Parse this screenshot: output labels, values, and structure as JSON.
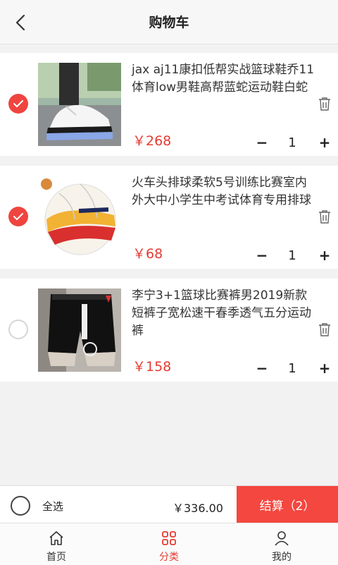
{
  "header": {
    "title": "购物车"
  },
  "items": [
    {
      "name": "jax aj11康扣低帮实战篮球鞋乔11体育low男鞋高帮蓝蛇运动鞋白蛇",
      "price": "￥268",
      "qty": "1",
      "checked": true,
      "image": "basketball-shoe"
    },
    {
      "name": "火车头排球柔软5号训练比赛室内外大中小学生中考试体育专用排球",
      "price": "￥68",
      "qty": "1",
      "checked": true,
      "image": "volleyball"
    },
    {
      "name": "李宁3+1篮球比赛裤男2019新款短裤子宽松速干春季透气五分运动裤",
      "price": "￥158",
      "qty": "1",
      "checked": false,
      "image": "basketball-shorts"
    }
  ],
  "qty_controls": {
    "minus": "−",
    "plus": "+"
  },
  "bottom_bar": {
    "select_all": "全选",
    "total": "￥336.00",
    "checkout": "结算（2）"
  },
  "tabbar": [
    {
      "label": "首页",
      "icon": "home-icon",
      "active": false
    },
    {
      "label": "分类",
      "icon": "category-icon",
      "active": true
    },
    {
      "label": "我的",
      "icon": "profile-icon",
      "active": false
    }
  ],
  "colors": {
    "accent": "#f3473f",
    "price": "#e63b32"
  }
}
